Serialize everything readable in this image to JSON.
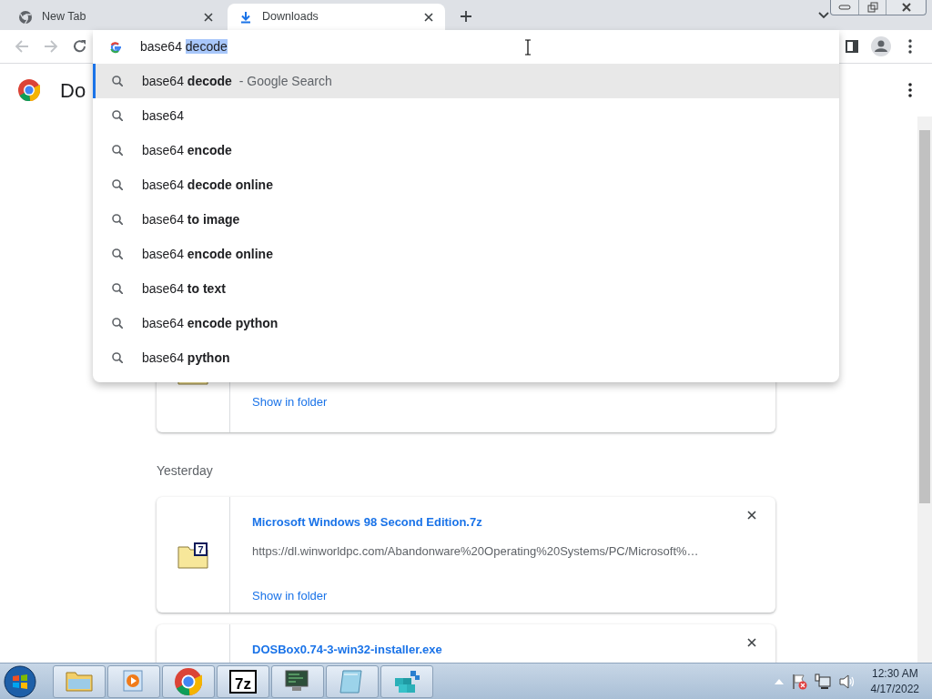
{
  "tabs": [
    {
      "title": "New Tab",
      "selected": false
    },
    {
      "title": "Downloads",
      "selected": true
    }
  ],
  "omnibox": {
    "typed": "base64 ",
    "autocomplete": "decode"
  },
  "suggestions": [
    {
      "text": "base64 **decode**",
      "source": "- Google Search",
      "selected": true
    },
    {
      "text": "base64",
      "selected": false
    },
    {
      "text": "base64 **encode**",
      "selected": false
    },
    {
      "text": "base64 **decode online**",
      "selected": false
    },
    {
      "text": "base64 **to image**",
      "selected": false
    },
    {
      "text": "base64 **encode online**",
      "selected": false
    },
    {
      "text": "base64 **to text**",
      "selected": false
    },
    {
      "text": "base64 **encode python**",
      "selected": false
    },
    {
      "text": "base64 **python**",
      "selected": false
    }
  ],
  "page": {
    "title": "Do"
  },
  "downloads": [
    {
      "kind": "partial",
      "action": "Show in folder"
    },
    {
      "kind": "section",
      "label": "Yesterday"
    },
    {
      "kind": "full",
      "name": "Microsoft Windows 98 Second Edition.7z",
      "url": "https://dl.winworldpc.com/Abandonware%20Operating%20Systems/PC/Microsoft%…",
      "icon_label": "7",
      "action": "Show in folder"
    },
    {
      "kind": "top",
      "name": "DOSBox0.74-3-win32-installer.exe"
    }
  ],
  "taskbar": [
    {
      "kind": "explorer"
    },
    {
      "kind": "media"
    },
    {
      "kind": "chrome"
    },
    {
      "kind": "sevenzip",
      "label": "7z"
    },
    {
      "kind": "monitor"
    },
    {
      "kind": "notepad"
    },
    {
      "kind": "cubes"
    }
  ],
  "clock": {
    "time": "12:30 AM",
    "date": "4/17/2022"
  }
}
